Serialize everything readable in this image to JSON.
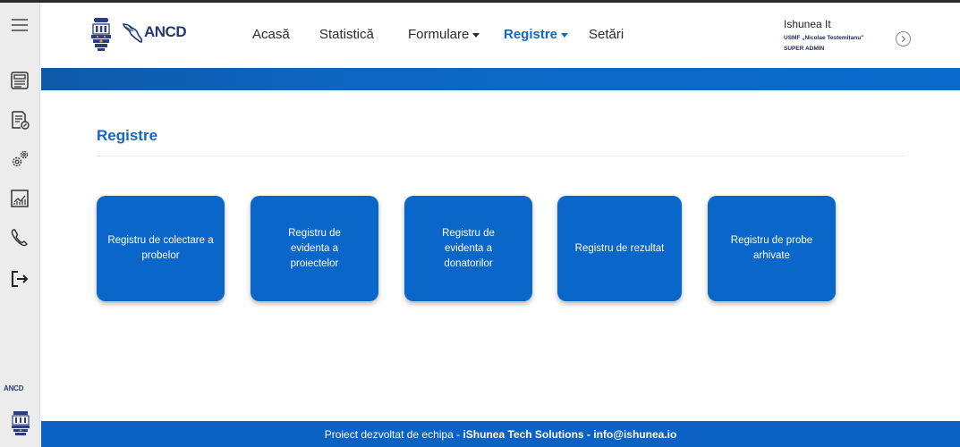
{
  "header": {
    "logo_text": "ANCD",
    "nav": [
      {
        "label": "Acasă",
        "has_caret": false,
        "active": false
      },
      {
        "label": "Statistică",
        "has_caret": false,
        "active": false
      },
      {
        "label": "Formulare",
        "has_caret": true,
        "active": false
      },
      {
        "label": "Registre",
        "has_caret": true,
        "active": true
      },
      {
        "label": "Setări",
        "has_caret": false,
        "active": false
      }
    ],
    "user": {
      "name": "Ishunea It",
      "organization": "USMF „Nicolae Testemițanu\"",
      "role": "SUPER ADMIN"
    }
  },
  "sidebar": {
    "icons": [
      "menu-icon",
      "registry-card-icon",
      "document-edit-icon",
      "settings-gears-icon",
      "report-chart-icon",
      "phone-icon",
      "logout-icon"
    ],
    "brand_text": "ANCD"
  },
  "main": {
    "title": "Registre",
    "cards": [
      {
        "label": "Registru de colectare a probelor"
      },
      {
        "label": "Registru de evidenta a proiectelor"
      },
      {
        "label": "Registru de evidenta a donatorilor"
      },
      {
        "label": "Registru de rezultat"
      },
      {
        "label": "Registru de probe arhivate"
      }
    ]
  },
  "footer": {
    "prefix": "Proiect dezvoltat de echipa - ",
    "company": "iShunea Tech Solutions",
    "separator": " - ",
    "email": "info@ishunea.io"
  },
  "colors": {
    "accent": "#1266c4",
    "card": "#0b66c9",
    "footer": "#0b62c4",
    "sidebar": "#ececec"
  }
}
